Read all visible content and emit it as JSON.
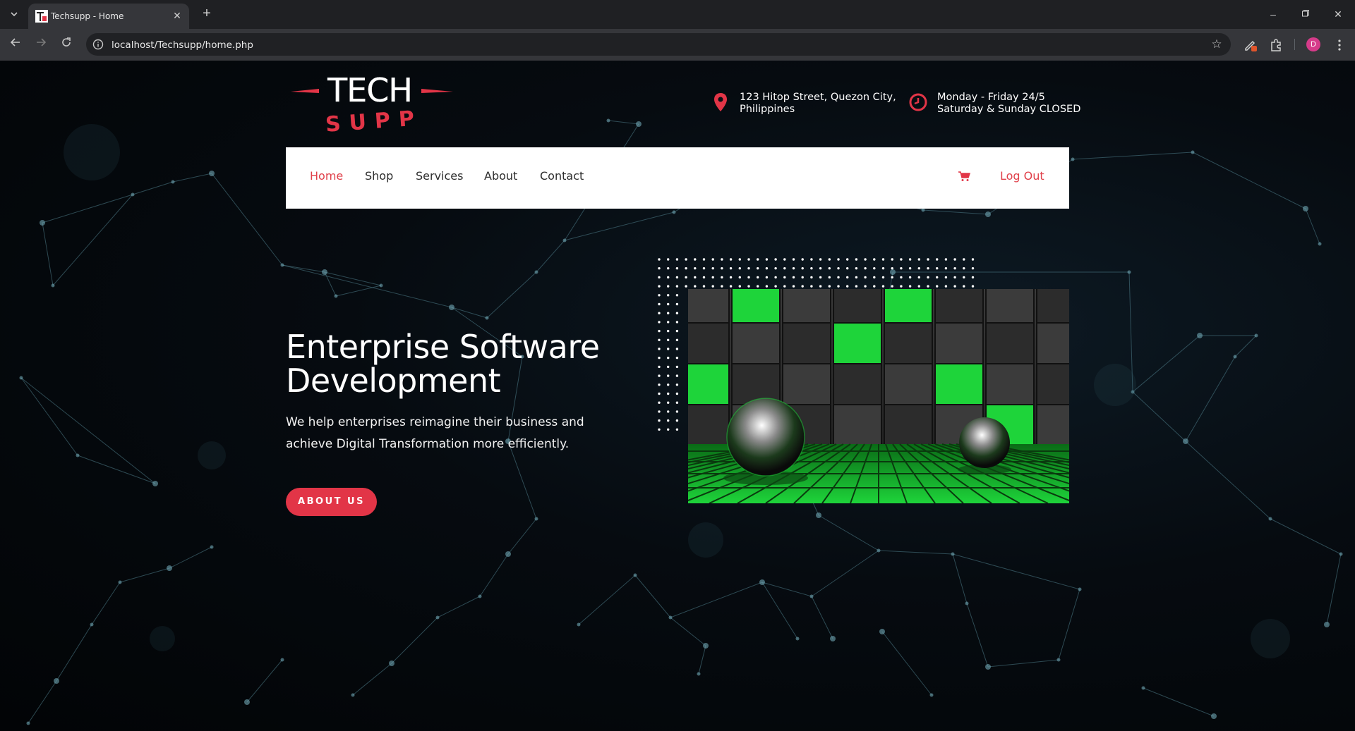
{
  "browser": {
    "tab_title": "Techsupp - Home",
    "url": "localhost/Techsupp/home.php",
    "profile_initial": "D",
    "icons": [
      "tab-list-icon",
      "close-icon",
      "new-tab-icon",
      "minimize-icon",
      "restore-icon",
      "close-window-icon",
      "back-icon",
      "forward-icon",
      "reload-icon",
      "site-info-icon",
      "bookmark-star-icon",
      "extension-edit-icon",
      "extensions-puzzle-icon",
      "more-menu-icon"
    ]
  },
  "header": {
    "logo_top": "TECH",
    "logo_bottom": "SUPP",
    "address": {
      "line1": "123 Hitop Street, Quezon City,",
      "line2": "Philippines",
      "icon": "location-pin-icon"
    },
    "hours": {
      "line1": "Monday - Friday 24/5",
      "line2": "Saturday & Sunday CLOSED",
      "icon": "clock-icon"
    }
  },
  "nav": {
    "items": [
      {
        "label": "Home",
        "active": true
      },
      {
        "label": "Shop",
        "active": false
      },
      {
        "label": "Services",
        "active": false
      },
      {
        "label": "About",
        "active": false
      },
      {
        "label": "Contact",
        "active": false
      }
    ],
    "cart_icon": "cart-icon",
    "logout_label": "Log Out"
  },
  "hero": {
    "title": "Enterprise Software Development",
    "description": "We help enterprises reimagine their business and achieve Digital Transformation more efficiently.",
    "button_label": "ABOUT US"
  },
  "colors": {
    "accent": "#e23547",
    "nav_active": "#e0404a",
    "navbar_bg": "#ffffff",
    "image_green": "#1ed43a"
  }
}
